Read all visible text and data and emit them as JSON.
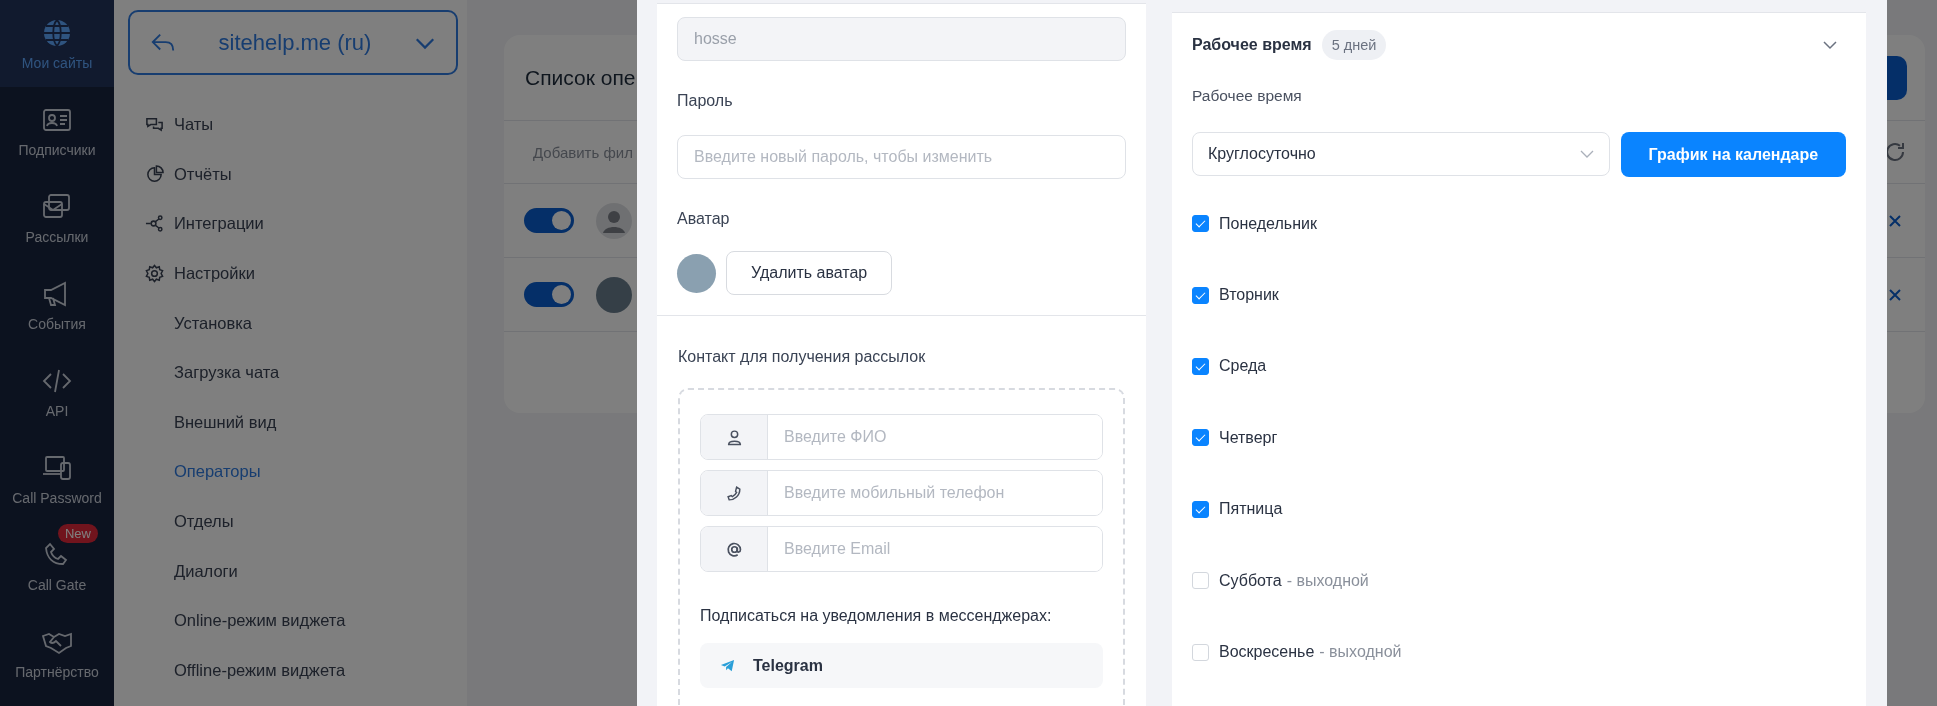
{
  "nav": [
    {
      "label": "Мои сайты",
      "selected": true
    },
    {
      "label": "Подписчики",
      "selected": false
    },
    {
      "label": "Рассылки",
      "selected": false
    },
    {
      "label": "События",
      "selected": false
    },
    {
      "label": "API",
      "selected": false
    },
    {
      "label": "Call Password",
      "selected": false
    },
    {
      "label": "Call Gate",
      "selected": false,
      "badge": "New"
    },
    {
      "label": "Партнёрство",
      "selected": false
    }
  ],
  "site_selector": {
    "value": "sitehelp.me (ru)"
  },
  "menu": [
    {
      "label": "Чаты",
      "selected": false
    },
    {
      "label": "Отчёты",
      "selected": false
    },
    {
      "label": "Интеграции",
      "selected": false
    },
    {
      "label": "Настройки",
      "selected": false,
      "children": [
        {
          "label": "Установка",
          "selected": false
        },
        {
          "label": "Загрузка чата",
          "selected": false
        },
        {
          "label": "Внешний вид",
          "selected": false
        },
        {
          "label": "Операторы",
          "selected": true
        },
        {
          "label": "Отделы",
          "selected": false
        },
        {
          "label": "Диалоги",
          "selected": false
        },
        {
          "label": "Online-режим виджета",
          "selected": false
        },
        {
          "label": "Offline-режим виджета",
          "selected": false
        }
      ]
    }
  ],
  "operators_card": {
    "title": "Список опе",
    "filter": "Добавить фил",
    "rows": [
      {
        "on": true,
        "kind": "generic"
      },
      {
        "on": true,
        "kind": "photo"
      }
    ]
  },
  "modal": {
    "profile": {
      "login": {
        "value": "hosse",
        "disabled": true
      },
      "password_label": "Пароль",
      "password_placeholder": "Введите новый пароль, чтобы изменить",
      "avatar_label": "Аватар",
      "delete_avatar": "Удалить аватар"
    },
    "contact": {
      "label": "Контакт для получения рассылок",
      "fields": [
        {
          "kind": "name",
          "placeholder": "Введите ФИО"
        },
        {
          "kind": "phone",
          "placeholder": "Введите мобильный телефон"
        },
        {
          "kind": "email",
          "placeholder": "Введите Email"
        }
      ],
      "messengers_label": "Подписаться на уведомления в мессенджерах:",
      "messengers": [
        {
          "label": "Telegram"
        }
      ]
    },
    "schedule": {
      "title": "Рабочее время",
      "badge": "5 дней",
      "expanded": true,
      "label": "Рабочее время",
      "mode": "Круглосуточно",
      "calendar_button": "График на календаре",
      "days": [
        {
          "label": "Понедельник",
          "checked": true
        },
        {
          "label": "Вторник",
          "checked": true
        },
        {
          "label": "Среда",
          "checked": true
        },
        {
          "label": "Четверг",
          "checked": true
        },
        {
          "label": "Пятница",
          "checked": true
        },
        {
          "label": "Суббота",
          "checked": false,
          "note": "- выходной"
        },
        {
          "label": "Воскресенье",
          "checked": false,
          "note": "- выходной"
        }
      ]
    }
  }
}
